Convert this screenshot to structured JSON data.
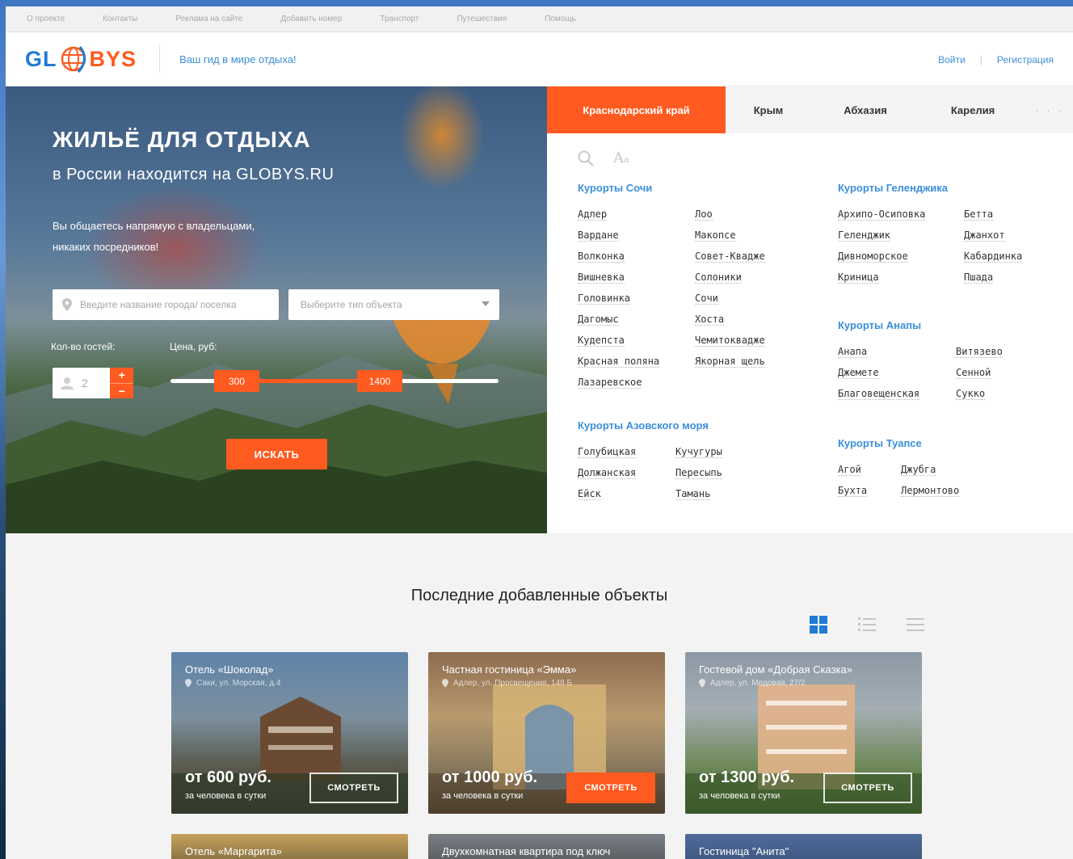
{
  "topnav": [
    "О проекте",
    "Контакты",
    "Реклама на сайте",
    "Добавить номер",
    "Транспорт",
    "Путешествия",
    "Помощь"
  ],
  "header": {
    "logo_left": "GL",
    "logo_right": "BYS",
    "slogan": "Ваш гид в мире отдыха!",
    "login": "Войти",
    "register": "Регистрация"
  },
  "hero": {
    "title": "ЖИЛЬЁ ДЛЯ ОТДЫХА",
    "subtitle": "в России находится на GLOBYS.RU",
    "text": "Вы общаетесь напрямую с владельцами, никаких посредников!",
    "city_placeholder": "Введите название города/ поселка",
    "type_placeholder": "Выберите тип объекта",
    "guests_label": "Кол-во гостей:",
    "price_label": "Цена, руб:",
    "guests_value": "2",
    "plus": "+",
    "minus": "−",
    "price_min": "300",
    "price_max": "1400",
    "search_button": "ИСКАТЬ"
  },
  "tabs": [
    "Краснодарский край",
    "Крым",
    "Абхазия",
    "Карелия",
    "· · ·"
  ],
  "tools": {
    "font_label": "A"
  },
  "regions": {
    "sochi": {
      "title": "Курорты Сочи",
      "col1": [
        "Адлер",
        "Вардане",
        "Волконка",
        "Вишневка",
        "Головинка",
        "Дагомыс",
        "Кудепста",
        "Красная поляна",
        "Лазаревское"
      ],
      "col2": [
        "Лоо",
        "Макопсе",
        "Совет-Квадже",
        "Солоники",
        "Сочи",
        "Хоста",
        "Чемитоквадже",
        "Якорная щель"
      ]
    },
    "gelendzhik": {
      "title": "Курорты Геленджика",
      "col1": [
        "Архипо-Осиповка",
        "Геленджик",
        "Дивноморское",
        "Криница"
      ],
      "col2": [
        "Бетта",
        "Джанхот",
        "Кабардинка",
        "Пшада"
      ]
    },
    "anapa": {
      "title": "Курорты Анапы",
      "col1": [
        "Анапа",
        "Джемете",
        "Благовещенская"
      ],
      "col2": [
        "Витязево",
        "Сенной",
        "Сукко"
      ]
    },
    "azov": {
      "title": "Курорты Азовского моря",
      "col1": [
        "Голубицкая",
        "Должанская",
        "Ейск"
      ],
      "col2": [
        "Кучугуры",
        "Пересыпь",
        "Тамань"
      ]
    },
    "tuapse": {
      "title": "Курорты Туапсе",
      "col1": [
        "Агой",
        "Бухта"
      ],
      "col2": [
        "Джубга",
        "Лермонтово"
      ]
    }
  },
  "latest": {
    "title": "Последние добавленные объекты",
    "cards": [
      {
        "title": "Отель «Шоколад»",
        "address": "Саки, ул. Морская, д.4",
        "price": "от 600 руб.",
        "unit": "за человека в сутки",
        "button": "СМОТРЕТЬ"
      },
      {
        "title": "Частная гостиница «Эмма»",
        "address": "Адлер, ул. Просвещения, 148 Б",
        "price": "от 1000 руб.",
        "unit": "за человека в сутки",
        "button": "СМОТРЕТЬ"
      },
      {
        "title": "Гостевой дом «Добрая Сказка»",
        "address": "Адлер, ул. Медовая, 27/2",
        "price": "от 1300 руб.",
        "unit": "за человека в сутки",
        "button": "СМОТРЕТЬ"
      }
    ],
    "cards_row2": [
      "Отель «Маргарита»",
      "Двухкомнатная квартира под ключ",
      "Гостиница \"Анита\""
    ]
  },
  "colors": {
    "accent": "#ff5a1f",
    "link": "#3a8fdc"
  }
}
